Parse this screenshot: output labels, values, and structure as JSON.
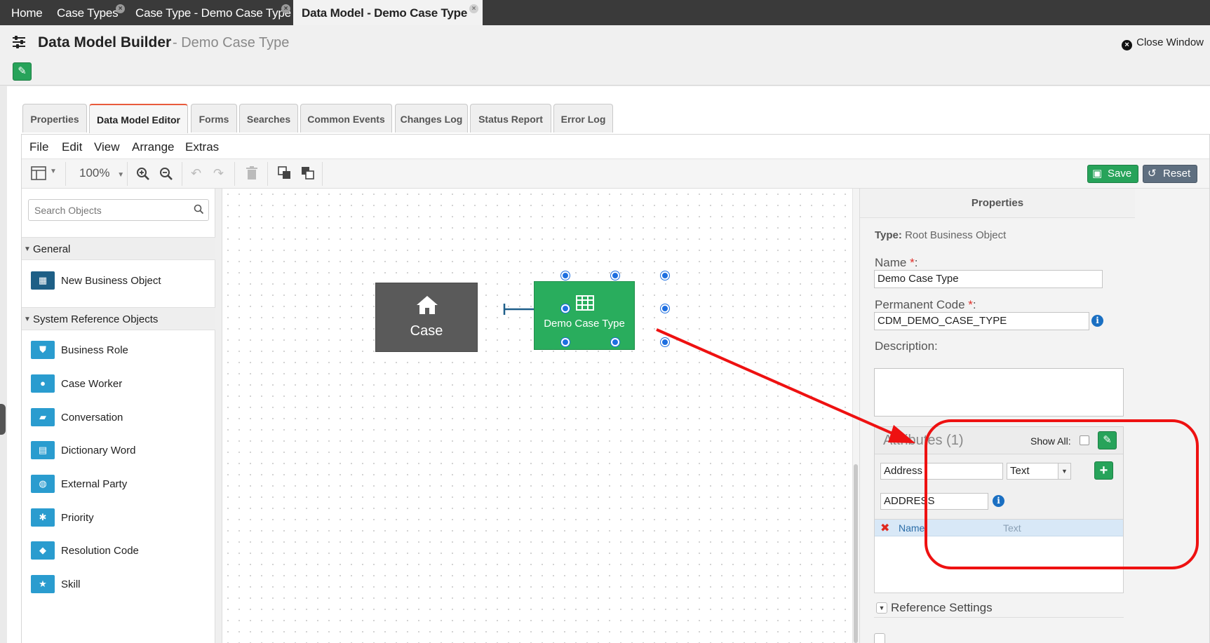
{
  "top_tabs": [
    {
      "label": "Home"
    },
    {
      "label": "Case Types"
    },
    {
      "label": "Case Type - Demo Case Type"
    },
    {
      "label": "Data Model - Demo Case Type"
    }
  ],
  "header": {
    "title": "Data Model Builder",
    "subtitle": "- Demo Case Type",
    "close_label": "Close Window"
  },
  "content_tabs": [
    {
      "label": "Properties"
    },
    {
      "label": "Data Model Editor"
    },
    {
      "label": "Forms"
    },
    {
      "label": "Searches"
    },
    {
      "label": "Common Events"
    },
    {
      "label": "Changes Log"
    },
    {
      "label": "Status Report"
    },
    {
      "label": "Error Log"
    }
  ],
  "menubar": [
    "File",
    "Edit",
    "View",
    "Arrange",
    "Extras"
  ],
  "toolbar": {
    "zoom": "100%",
    "save_label": "Save",
    "reset_label": "Reset"
  },
  "left_panel": {
    "search_placeholder": "Search Objects",
    "general_label": "General",
    "general_items": [
      {
        "label": "New Business Object",
        "icon": "table-icon"
      }
    ],
    "system_label": "System Reference Objects",
    "system_items": [
      {
        "label": "Business Role",
        "icon": "shield-icon"
      },
      {
        "label": "Case Worker",
        "icon": "user-icon"
      },
      {
        "label": "Conversation",
        "icon": "chat-icon"
      },
      {
        "label": "Dictionary Word",
        "icon": "document-icon"
      },
      {
        "label": "External Party",
        "icon": "globe-icon"
      },
      {
        "label": "Priority",
        "icon": "asterisk-icon"
      },
      {
        "label": "Resolution Code",
        "icon": "tag-icon"
      },
      {
        "label": "Skill",
        "icon": "star-icon"
      }
    ]
  },
  "canvas": {
    "case_node": "Case",
    "demo_node": "Demo Case Type"
  },
  "properties": {
    "title": "Properties",
    "type_label": "Type:",
    "type_value": "Root Business Object",
    "name_label": "Name",
    "name_value": "Demo Case Type",
    "code_label": "Permanent Code",
    "code_value": "CDM_DEMO_CASE_TYPE",
    "description_label": "Description:",
    "attributes_title": "Attributes (1)",
    "show_all_label": "Show All:",
    "attr_name_value": "Address",
    "attr_type_value": "Text",
    "attr_code_value": "ADDRESS",
    "attr_rows": [
      {
        "name": "Name",
        "type": "Text"
      }
    ],
    "reference_settings_label": "Reference Settings"
  },
  "colors": {
    "green": "#29ad5d",
    "case_gray": "#5a5a5a",
    "icon_blue": "#2a9ccf",
    "annotation_red": "#ee1111"
  }
}
